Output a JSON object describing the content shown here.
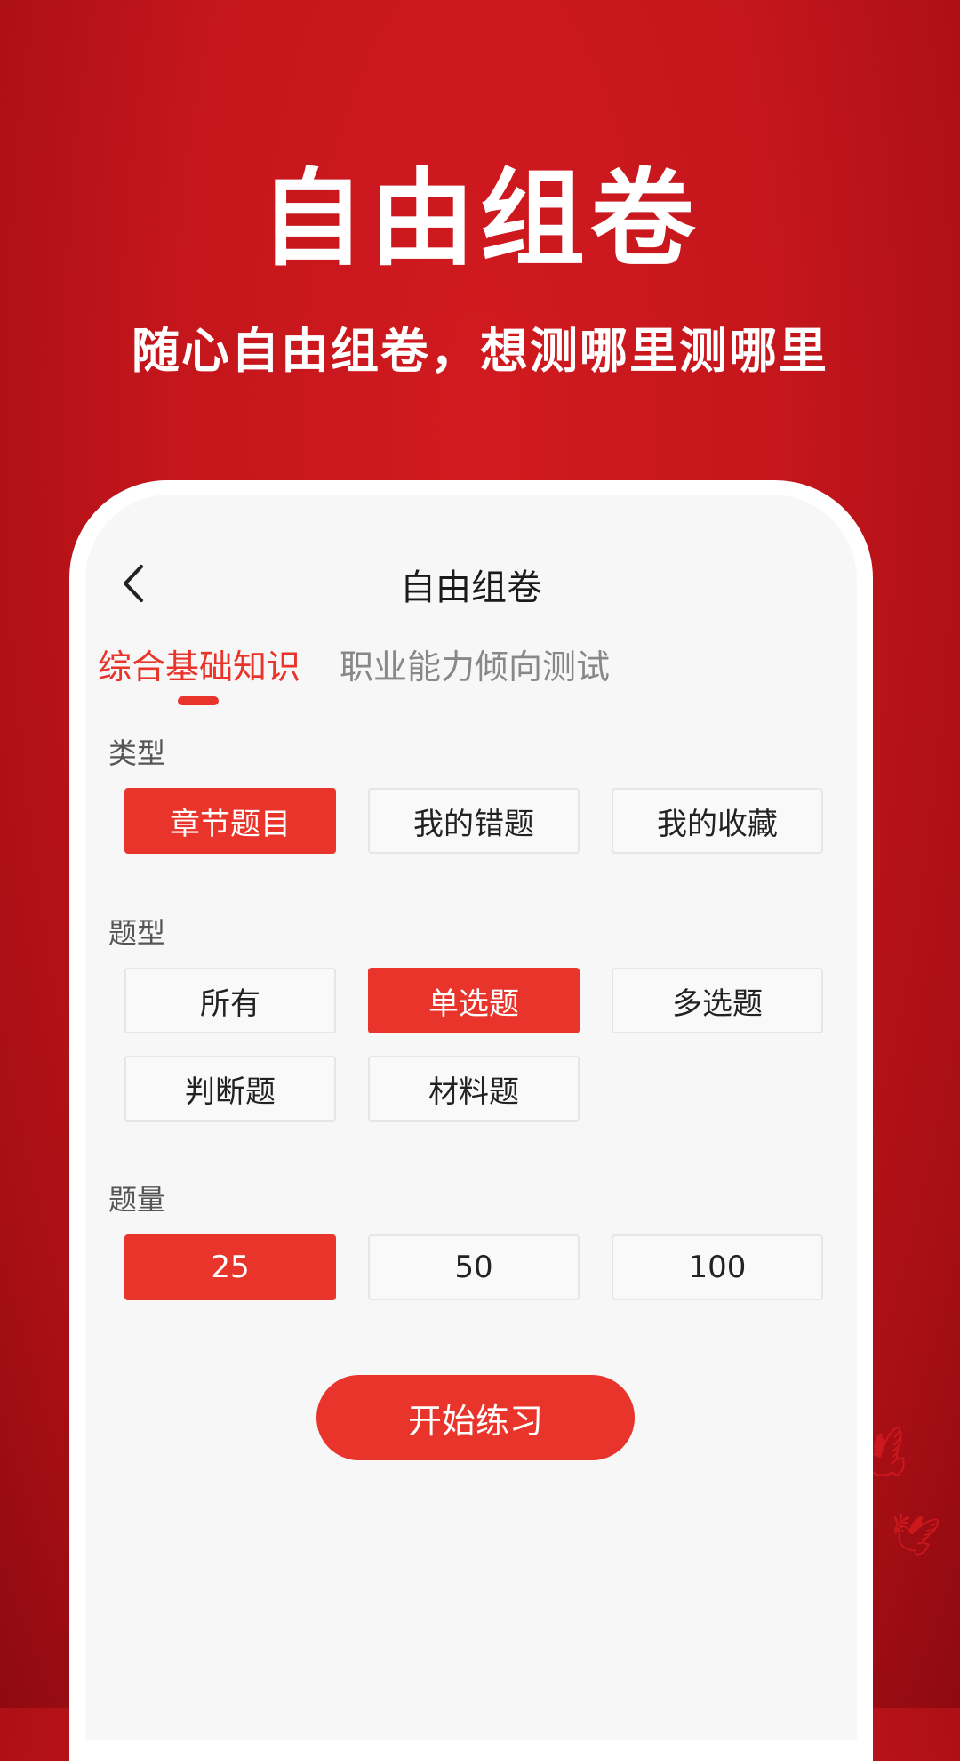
{
  "promo": {
    "headline": "自由组卷",
    "subline": "随心自由组卷，想测哪里测哪里"
  },
  "app": {
    "title": "自由组卷",
    "back_icon": "chevron-left-icon",
    "tabs": [
      {
        "label": "综合基础知识",
        "active": true
      },
      {
        "label": "职业能力倾向测试",
        "active": false
      }
    ],
    "type_section": {
      "label": "类型",
      "options": [
        {
          "label": "章节题目",
          "selected": true
        },
        {
          "label": "我的错题",
          "selected": false
        },
        {
          "label": "我的收藏",
          "selected": false
        }
      ]
    },
    "question_type_section": {
      "label": "题型",
      "options": [
        {
          "label": "所有",
          "selected": false
        },
        {
          "label": "单选题",
          "selected": true
        },
        {
          "label": "多选题",
          "selected": false
        },
        {
          "label": "判断题",
          "selected": false
        },
        {
          "label": "材料题",
          "selected": false
        }
      ]
    },
    "quantity_section": {
      "label": "题量",
      "options": [
        {
          "label": "25",
          "selected": true
        },
        {
          "label": "50",
          "selected": false
        },
        {
          "label": "100",
          "selected": false
        }
      ]
    },
    "start_button": "开始练习"
  },
  "colors": {
    "background": "#c4161c",
    "accent": "#e8342a",
    "screen": "#f7f7f7"
  }
}
